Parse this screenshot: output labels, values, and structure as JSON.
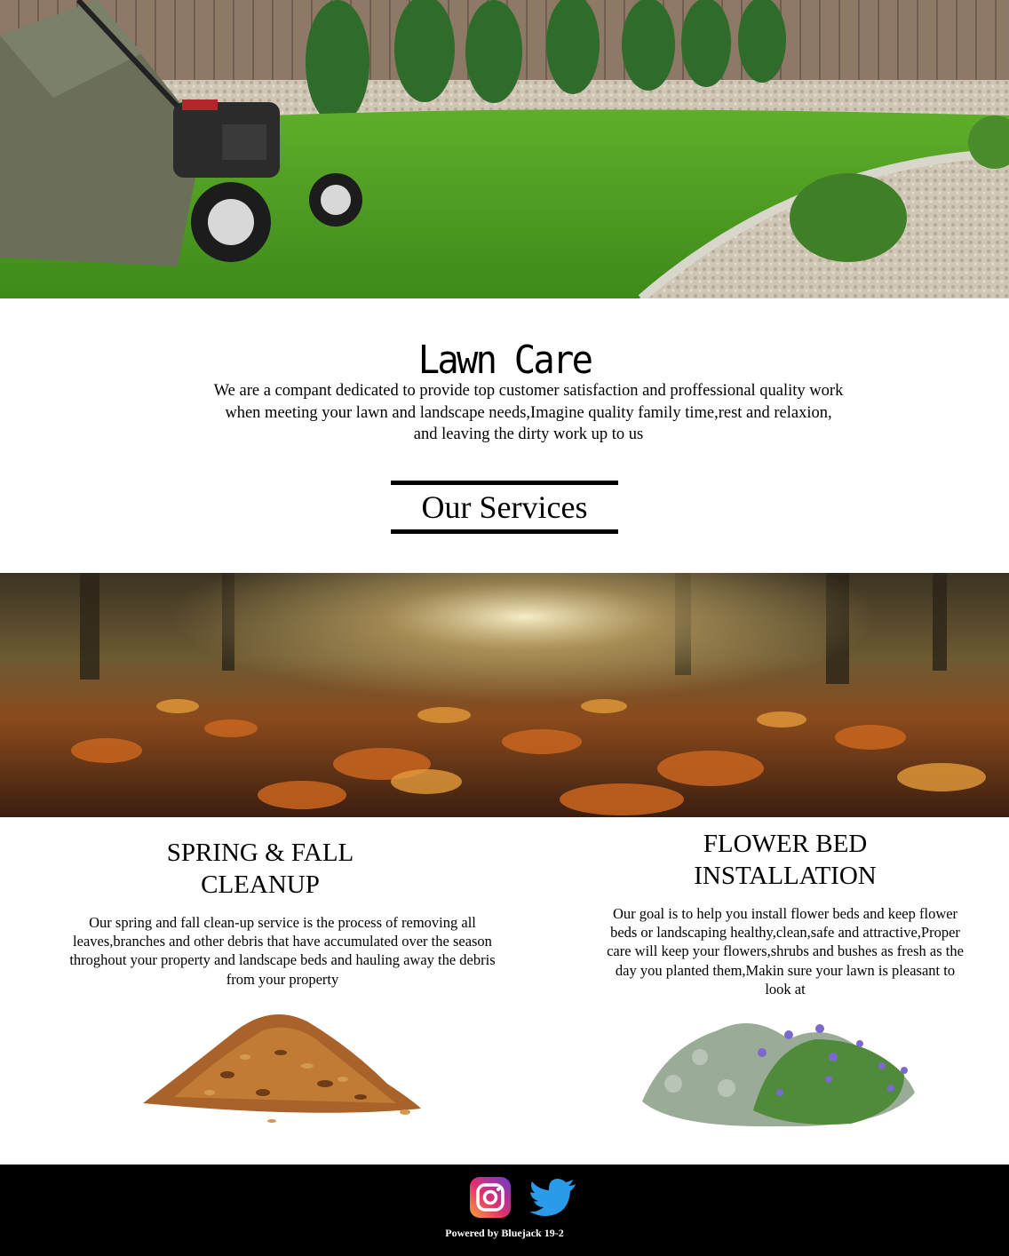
{
  "hero": {
    "image": "lawn-mower-on-green-lawn"
  },
  "intro": {
    "title": "Lawn Care",
    "line1": "We are a compant dedicated to provide top customer satisfaction and proffessional quality work",
    "line2": "when meeting your lawn and landscape needs,Imagine quality family time,rest and relaxion,",
    "line3": "and leaving the dirty work up to us"
  },
  "services_heading": "Our Services",
  "banner": {
    "image": "autumn-leaves-forest"
  },
  "services": [
    {
      "title_line1": "SPRING & FALL",
      "title_line2": "CLEANUP",
      "text_line1": "Our spring and fall clean-up service is the process of removing all",
      "text_line2": "leaves,branches and other debris that have accumulated over the season",
      "text_line3": "throghout your property and landscape beds and hauling away the debris",
      "text_line4": "from your property",
      "image": "leaf-pile"
    },
    {
      "title_line1": "FLOWER BED",
      "title_line2": "INSTALLATION",
      "text_line1": "Our goal is to help you install flower beds and keep flower",
      "text_line2": "beds or landscaping healthy,clean,safe and attractive,Proper",
      "text_line3": "care will keep your flowers,shrubs and bushes as fresh as the",
      "text_line4": "day you planted them,Makin sure your lawn is pleasant to",
      "text_line5": "look at",
      "image": "flowering-shrub"
    }
  ],
  "footer": {
    "icons": [
      "instagram-icon",
      "twitter-icon"
    ],
    "powered_by": "Powered by Bluejack 19-2",
    "background": "#000000"
  }
}
